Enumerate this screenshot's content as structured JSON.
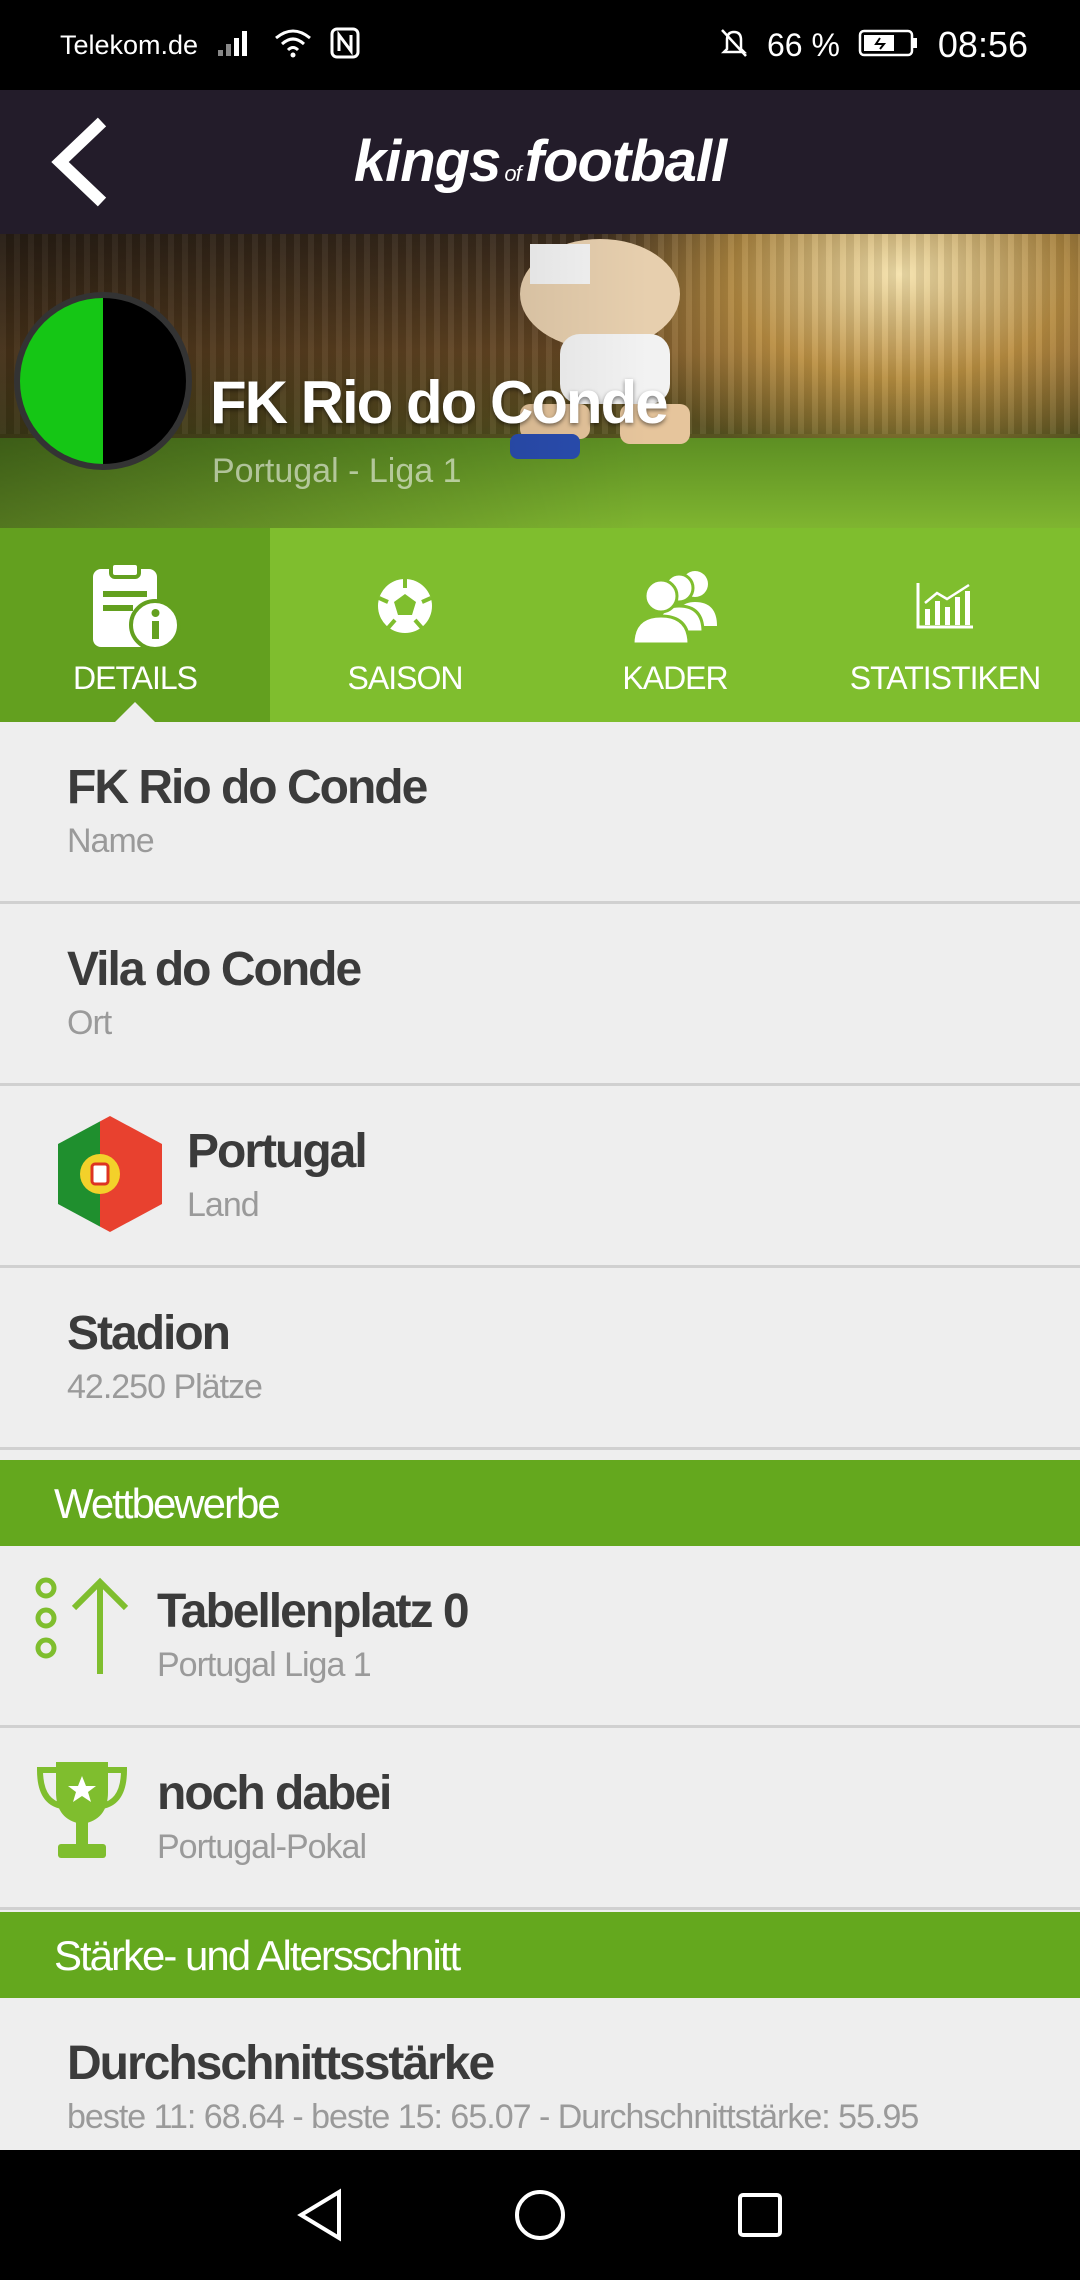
{
  "status_bar": {
    "carrier": "Telekom.de",
    "battery": "66 %",
    "time": "08:56"
  },
  "app_bar": {
    "logo_part1": "kings",
    "logo_of": "of",
    "logo_part2": "football"
  },
  "club": {
    "name": "FK Rio do Conde",
    "league": "Portugal - Liga 1",
    "badge_colors": [
      "#15c615",
      "#000000"
    ]
  },
  "tabs": [
    {
      "label": "DETAILS",
      "icon": "details-icon",
      "active": true
    },
    {
      "label": "SAISON",
      "icon": "soccer-ball-icon",
      "active": false
    },
    {
      "label": "KADER",
      "icon": "team-icon",
      "active": false
    },
    {
      "label": "STATISTIKEN",
      "icon": "bar-chart-icon",
      "active": false
    }
  ],
  "details": [
    {
      "title": "FK Rio do Conde",
      "sub": "Name"
    },
    {
      "title": "Vila do Conde",
      "sub": "Ort"
    },
    {
      "title": "Portugal",
      "sub": "Land",
      "icon": "portugal-flag-icon"
    },
    {
      "title": "Stadion",
      "sub": "42.250 Plätze"
    }
  ],
  "sections": {
    "competitions": "Wettbewerbe",
    "strength": "Stärke- und Altersschnitt"
  },
  "competitions": [
    {
      "title": "Tabellenplatz 0",
      "sub": "Portugal Liga 1",
      "icon": "rank-up-icon"
    },
    {
      "title": "noch dabei",
      "sub": "Portugal-Pokal",
      "icon": "trophy-icon"
    }
  ],
  "strength": {
    "title": "Durchschnittsstärke",
    "sub": "beste 11: 68.64 - beste 15: 65.07 - Durchschnittstärke: 55.95"
  },
  "colors": {
    "accent_green": "#7fbe2e",
    "section_green": "#64a81e",
    "header_dark": "#231c2a"
  }
}
